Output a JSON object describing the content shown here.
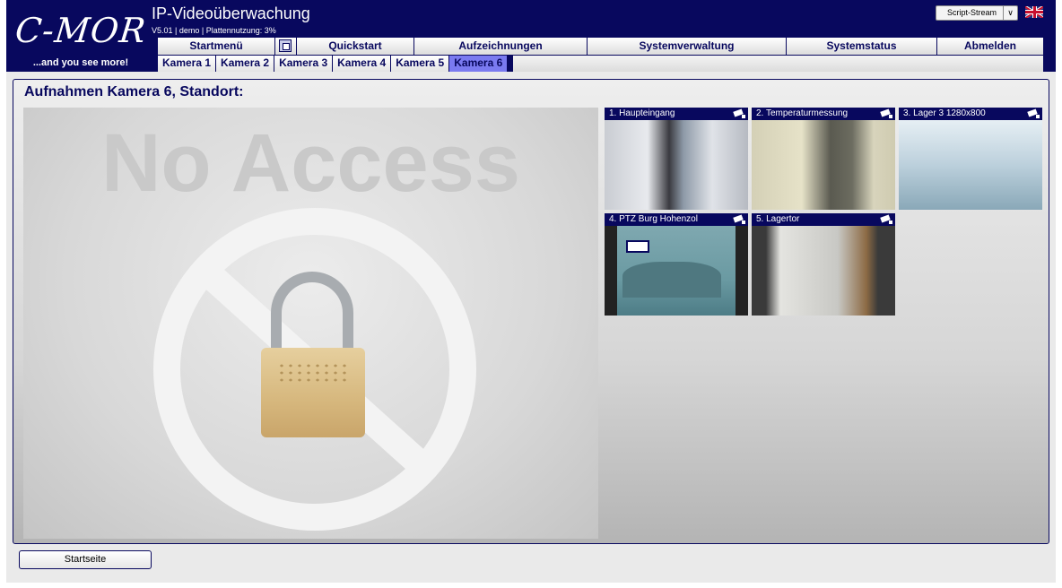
{
  "branding": {
    "logo_text": "C-MOR",
    "tagline": "...and you see more!"
  },
  "header": {
    "title": "IP-Videoüberwachung",
    "version_info": "V5.01 | demo | Plattennutzung: 3%",
    "stream_select": "Script-Stream",
    "language_flag": "uk-flag-icon"
  },
  "menu": {
    "items": [
      {
        "label": "Startmenü"
      },
      {
        "label": "Quickstart"
      },
      {
        "label": "Aufzeichnungen"
      },
      {
        "label": "Systemverwaltung"
      },
      {
        "label": "Systemstatus"
      },
      {
        "label": "Abmelden"
      }
    ],
    "icon": "fullscreen-icon"
  },
  "tabs": {
    "items": [
      {
        "label": "Kamera 1"
      },
      {
        "label": "Kamera 2"
      },
      {
        "label": "Kamera 3"
      },
      {
        "label": "Kamera 4"
      },
      {
        "label": "Kamera 5"
      },
      {
        "label": "Kamera 6",
        "active": true
      }
    ]
  },
  "panel": {
    "title": "Aufnahmen Kamera 6, Standort:",
    "main_overlay_text": "No Access"
  },
  "thumbnails": [
    {
      "caption": "1. Haupteingang"
    },
    {
      "caption": "2. Temperaturmessung"
    },
    {
      "caption": "3. Lager 3 1280x800"
    },
    {
      "caption": "4. PTZ Burg Hohenzol"
    },
    {
      "caption": "5. Lagertor"
    }
  ],
  "footer": {
    "start_button": "Startseite"
  },
  "colors": {
    "brand_navy": "#08085e",
    "active_tab": "#7a7af0"
  }
}
